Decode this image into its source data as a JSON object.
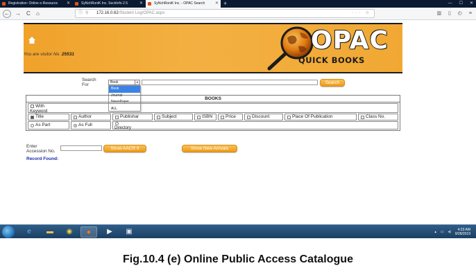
{
  "browser": {
    "tabs": [
      {
        "title": "Registration: Online e-Resource",
        "active": false
      },
      {
        "title": "SyNchRoniK Inc. SeckInfo 2.5",
        "active": false
      },
      {
        "title": "SyNchRoniK Inc. - OPAC Search",
        "active": true
      }
    ],
    "new_tab": "+",
    "window_controls": [
      "—",
      "☐",
      "✕"
    ],
    "url": {
      "host": "172.16.0.62",
      "path": "/Student Log/OPAC.aspx"
    },
    "nav": {
      "back": "←",
      "forward": "→",
      "reload": "C",
      "home": "⌂"
    }
  },
  "banner": {
    "visitor_prefix": "You are visitor No.",
    "visitor_number": "25531",
    "logo_title": "OPAC",
    "logo_subtitle": "QUICK BOOKS"
  },
  "search": {
    "label_line1": "Search",
    "label_line2": "For",
    "selected_type": "Book",
    "type_options": [
      "Book",
      "Journal",
      "NewsPaper",
      "ALL"
    ],
    "button_label": "Search"
  },
  "books_table": {
    "header": "BOOKS",
    "with_keyword": {
      "line1": "With",
      "line2": "Keyword"
    },
    "fields": [
      {
        "label": "Title",
        "checked": true
      },
      {
        "label": "Author",
        "checked": false
      },
      {
        "label": "Publishar",
        "checked": false
      },
      {
        "label": "Subject",
        "checked": false
      },
      {
        "label": "ISBN",
        "checked": false
      },
      {
        "label": "Price",
        "checked": false
      },
      {
        "label": "Discount",
        "checked": false
      },
      {
        "label": "Place Of Publication",
        "checked": false
      },
      {
        "label": "Class No.",
        "checked": false
      }
    ],
    "match_options": [
      {
        "label": "As Part",
        "selected": false
      },
      {
        "label": "As Full",
        "selected": true
      }
    ],
    "directory_label": "Directory"
  },
  "accession": {
    "label_line1": "Enter",
    "label_line2": "Accession No.",
    "aacr_button": "Show AACR II",
    "new_arrivals_button": "Show New Arrivals"
  },
  "record_found": "Record Found:",
  "taskbar": {
    "time": "4:33 AM",
    "date": "9/28/2019"
  },
  "caption": "Fig.10.4 (e) Online Public Access Catalogue",
  "colors": {
    "banner": "#f2a93a",
    "button": "#f4a52a",
    "record_found": "#1a2aa8",
    "dropdown_selected": "#3b83e6"
  }
}
